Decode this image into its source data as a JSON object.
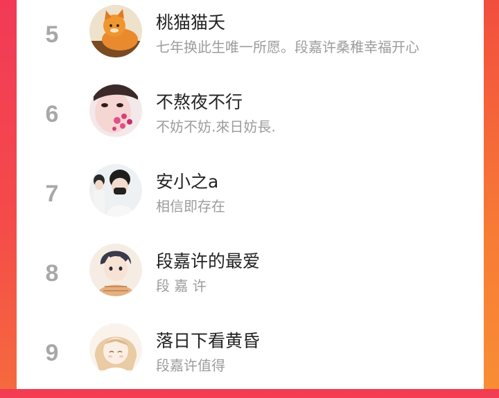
{
  "ranking": {
    "rows": [
      {
        "rank": "5",
        "nickname": "桃猫猫夭",
        "signature": "七年换此生唯一所愿。段嘉许桑稚幸福开心"
      },
      {
        "rank": "6",
        "nickname": "不熬夜不行",
        "signature": "不妨不妨.來日妨長."
      },
      {
        "rank": "7",
        "nickname": "安小之a",
        "signature": "相信即存在"
      },
      {
        "rank": "8",
        "nickname": "段嘉许的最爱",
        "signature": "段 嘉 许"
      },
      {
        "rank": "9",
        "nickname": "落日下看黄昏",
        "signature": "段嘉许值得"
      }
    ]
  },
  "colors": {
    "background_gradient_top": "#f23c53",
    "background_gradient_bottom": "#f7703a",
    "rank_number": "#a8a8a8",
    "nickname": "#222222",
    "signature": "#9c9c9c"
  }
}
